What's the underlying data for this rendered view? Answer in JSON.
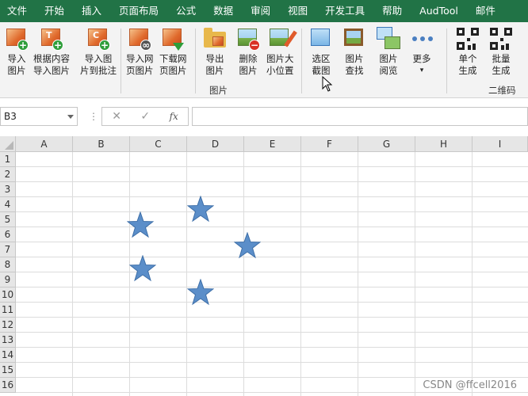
{
  "menubar": {
    "tabs": [
      "文件",
      "开始",
      "插入",
      "页面布局",
      "公式",
      "数据",
      "审阅",
      "视图",
      "开发工具",
      "帮助",
      "AudTool",
      "邮件"
    ]
  },
  "ribbon": {
    "buttons": [
      {
        "line1": "导入",
        "line2": "图片",
        "icon": "import-picture-icon"
      },
      {
        "line1": "根据内容",
        "line2": "导入图片",
        "icon": "import-by-content-icon"
      },
      {
        "line1": "导入图",
        "line2": "片到批注",
        "icon": "import-to-comment-icon"
      },
      {
        "line1": "导入网",
        "line2": "页图片",
        "icon": "import-web-picture-icon"
      },
      {
        "line1": "下载网",
        "line2": "页图片",
        "icon": "download-web-picture-icon"
      },
      {
        "line1": "导出",
        "line2": "图片",
        "icon": "export-picture-icon"
      },
      {
        "line1": "删除",
        "line2": "图片",
        "icon": "delete-picture-icon"
      },
      {
        "line1": "图片大",
        "line2": "小位置",
        "icon": "picture-size-icon"
      },
      {
        "line1": "选区",
        "line2": "截图",
        "icon": "selection-screenshot-icon"
      },
      {
        "line1": "图片",
        "line2": "查找",
        "icon": "picture-find-icon"
      },
      {
        "line1": "图片",
        "line2": "阅览",
        "icon": "picture-view-icon"
      },
      {
        "line1": "更多",
        "line2": "▾",
        "icon": "more-icon"
      },
      {
        "line1": "单个",
        "line2": "生成",
        "icon": "qr-single-icon"
      },
      {
        "line1": "批量",
        "line2": "生成",
        "icon": "qr-batch-icon"
      }
    ],
    "group_pictures": "图片",
    "group_qrcode": "二维码"
  },
  "formula_bar": {
    "name_box": "B3",
    "cancel": "✕",
    "confirm": "✓",
    "fx": "fx",
    "value": ""
  },
  "sheet": {
    "columns": [
      "A",
      "B",
      "C",
      "D",
      "E",
      "F",
      "G",
      "H",
      "I"
    ],
    "rows": [
      "1",
      "2",
      "3",
      "4",
      "5",
      "6",
      "7",
      "8",
      "9",
      "10",
      "11",
      "12",
      "13",
      "14",
      "15",
      "16"
    ],
    "star_color": "#5b8ec9"
  },
  "watermark": "CSDN @ffcell2016"
}
